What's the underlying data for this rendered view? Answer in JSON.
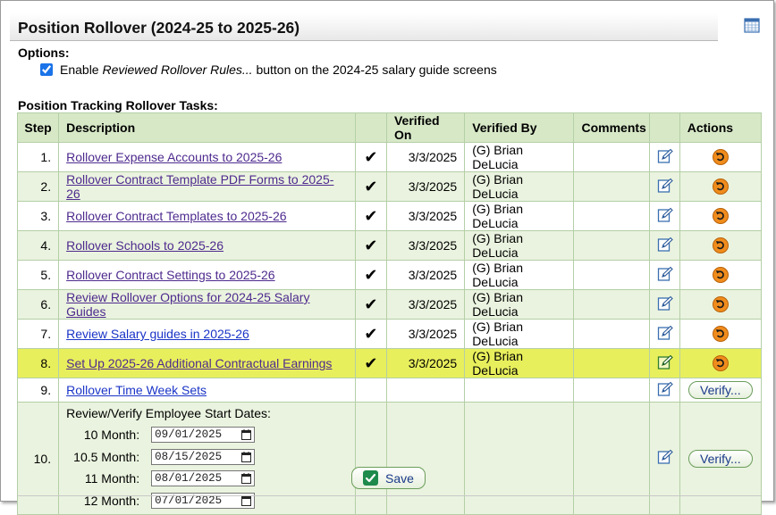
{
  "window": {
    "title": "Position Rollover (2024-25 to 2025-26)"
  },
  "options": {
    "label": "Options:",
    "enable_prefix": "Enable ",
    "enable_italic": "Reviewed Rollover Rules...",
    "enable_suffix": " button on the 2024-25 salary guide screens",
    "checked": true
  },
  "tasks_label": "Position Tracking Rollover Tasks:",
  "columns": {
    "step": "Step",
    "description": "Description",
    "verified_on": "Verified On",
    "verified_by": "Verified By",
    "comments": "Comments",
    "actions": "Actions"
  },
  "rows": [
    {
      "step": "1.",
      "description": "Rollover Expense Accounts to 2025-26",
      "check": "✔",
      "verified_on": "3/3/2025",
      "verified_by": "(G) Brian DeLucia"
    },
    {
      "step": "2.",
      "description": "Rollover Contract Template PDF Forms to 2025-26",
      "check": "✔",
      "verified_on": "3/3/2025",
      "verified_by": "(G) Brian DeLucia"
    },
    {
      "step": "3.",
      "description": "Rollover Contract Templates to 2025-26",
      "check": "✔",
      "verified_on": "3/3/2025",
      "verified_by": "(G) Brian DeLucia"
    },
    {
      "step": "4.",
      "description": "Rollover Schools to 2025-26",
      "check": "✔",
      "verified_on": "3/3/2025",
      "verified_by": "(G) Brian DeLucia"
    },
    {
      "step": "5.",
      "description": "Rollover Contract Settings to 2025-26",
      "check": "✔",
      "verified_on": "3/3/2025",
      "verified_by": "(G) Brian DeLucia"
    },
    {
      "step": "6.",
      "description": "Review Rollover Options for 2024-25 Salary Guides",
      "check": "✔",
      "verified_on": "3/3/2025",
      "verified_by": "(G) Brian DeLucia"
    },
    {
      "step": "7.",
      "description": "Review Salary guides in 2025-26",
      "check": "✔",
      "verified_on": "3/3/2025",
      "verified_by": "(G) Brian DeLucia"
    },
    {
      "step": "8.",
      "description": "Set Up 2025-26 Additional Contractual Earnings",
      "check": "✔",
      "verified_on": "3/3/2025",
      "verified_by": "(G) Brian DeLucia"
    },
    {
      "step": "9.",
      "description": "Rollover Time Week Sets",
      "verify_label": "Verify..."
    }
  ],
  "row10": {
    "step": "10.",
    "title": "Review/Verify Employee Start Dates:",
    "dates": [
      {
        "label": "10 Month:",
        "value": "09/01/2025"
      },
      {
        "label": "10.5 Month:",
        "value": "08/15/2025"
      },
      {
        "label": "11 Month:",
        "value": "08/01/2025"
      },
      {
        "label": "12 Month:",
        "value": "07/01/2025"
      }
    ],
    "verify_label": "Verify..."
  },
  "save_label": "Save",
  "colors": {
    "header_green": "#d7e8c7",
    "row_green": "#eaf3df",
    "highlight": "#e8ef5c",
    "link_visited": "#4e2a8e",
    "link": "#1a34c7",
    "undo_orange": "#f08c1c"
  }
}
